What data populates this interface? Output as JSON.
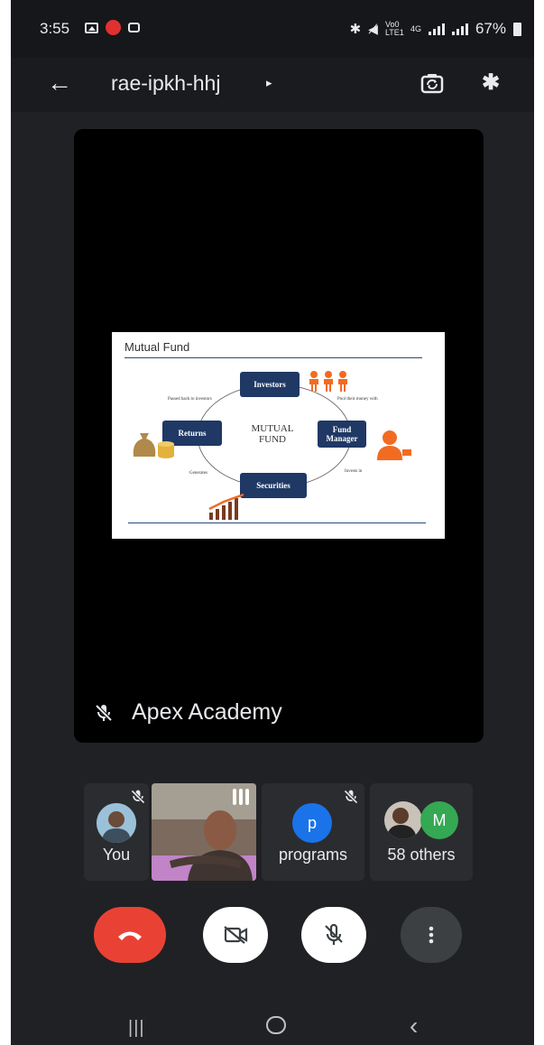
{
  "status_bar": {
    "time": "3:55",
    "volte": "Vo0 LTE1",
    "network": "4G",
    "battery": "67%"
  },
  "app_bar": {
    "meeting_code": "rae-ipkh-hhj",
    "caret": "▸"
  },
  "presentation": {
    "presenter_name": "Apex Academy",
    "slide": {
      "title": "Mutual Fund",
      "center_label_line1": "MUTUAL",
      "center_label_line2": "FUND",
      "boxes": {
        "investors": "Investors",
        "returns": "Returns",
        "fund_manager_line1": "Fund",
        "fund_manager_line2": "Manager",
        "securities": "Securities"
      },
      "arrow_notes": {
        "top_left": "Passed back to investors",
        "top_right": "Pool their money with",
        "bottom_left": "Generates",
        "bottom_right": "Invests in"
      }
    }
  },
  "participants": [
    {
      "label": "You"
    },
    {
      "label": ""
    },
    {
      "label": "programs",
      "initial": "p"
    },
    {
      "label": "58 others",
      "initial": "M"
    }
  ],
  "colors": {
    "end_call": "#e94235",
    "background": "#202124",
    "tile": "#2b2c30",
    "slide_box": "#1f3864",
    "accent_orange": "#f26b21",
    "avatar_blue": "#1a73e8",
    "avatar_green": "#34a853"
  },
  "icons": {
    "back": "arrow-left",
    "switch_camera": "switch-camera",
    "bluetooth": "bluetooth",
    "mic_off": "mic-off",
    "end_call": "phone-hangup",
    "camera_off": "video-off",
    "more": "more-vertical"
  }
}
